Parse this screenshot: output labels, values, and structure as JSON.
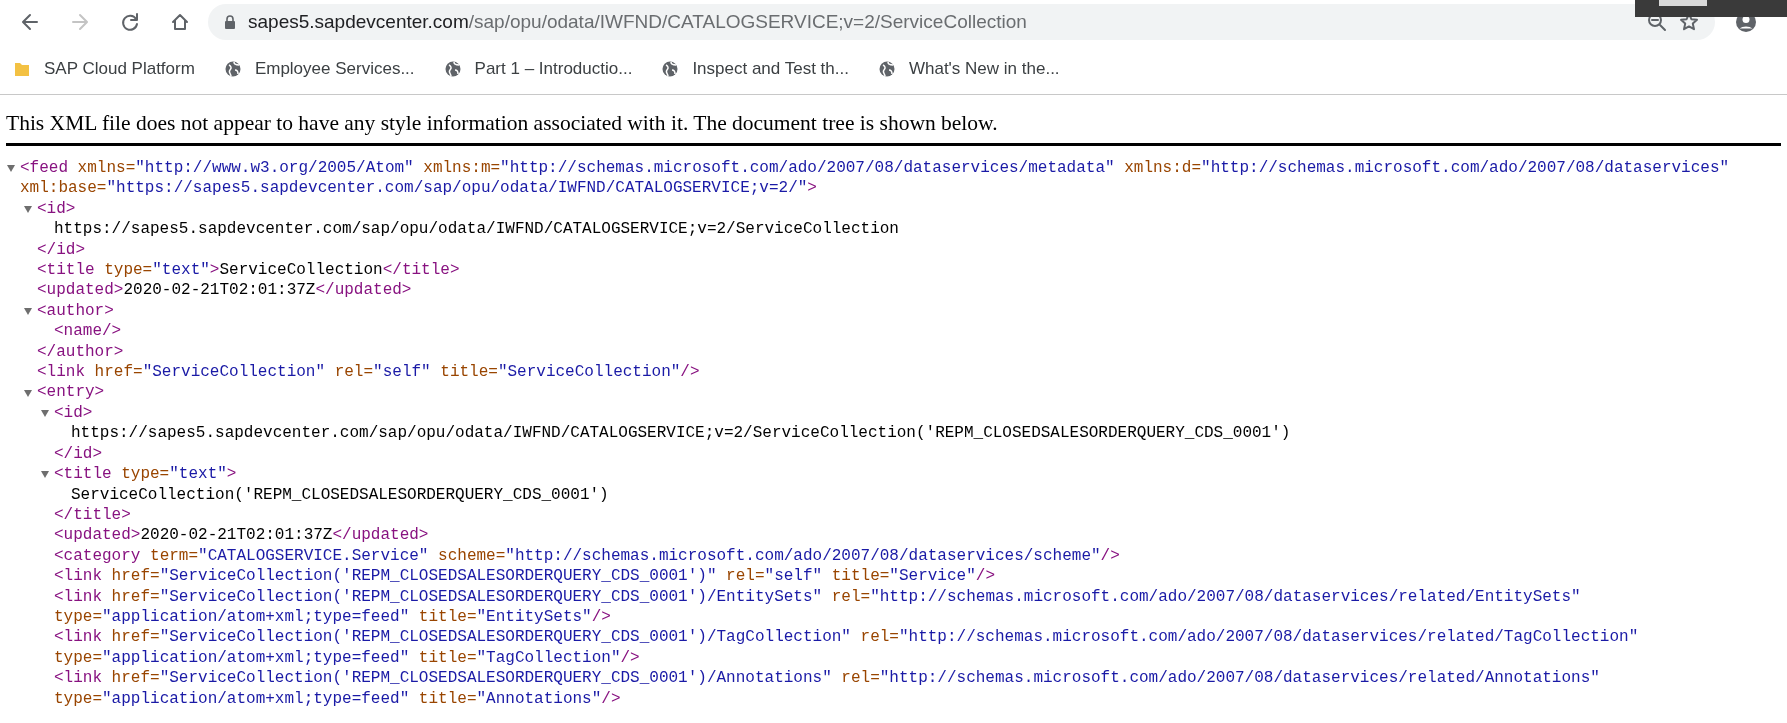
{
  "browser": {
    "back": {
      "disabled": false
    },
    "forward": {
      "disabled": true
    },
    "address": {
      "host": "sapes5.sapdevcenter.com",
      "path": "/sap/opu/odata/IWFND/CATALOGSERVICE;v=2/ServiceCollection"
    },
    "bookmarks": [
      {
        "kind": "folder",
        "label": "SAP Cloud Platform"
      },
      {
        "kind": "page",
        "label": "Employee Services..."
      },
      {
        "kind": "page",
        "label": "Part 1 – Introductio..."
      },
      {
        "kind": "page",
        "label": "Inspect and Test th..."
      },
      {
        "kind": "page",
        "label": "What's New in the..."
      }
    ]
  },
  "notice": "This XML file does not appear to have any style information associated with it. The document tree is shown below.",
  "xml_tree": {
    "expanded": true,
    "open": [
      [
        {
          "kind": "tag",
          "text": "<feed"
        },
        {
          "kind": "attr",
          "text": " xmlns="
        },
        {
          "kind": "value",
          "text": "\"http://www.w3.org/2005/Atom\""
        },
        {
          "kind": "attr",
          "text": " xmlns:m="
        },
        {
          "kind": "value",
          "text": "\"http://schemas.microsoft.com/ado/2007/08/dataservices/metadata\""
        },
        {
          "kind": "attr",
          "text": " xmlns:d="
        },
        {
          "kind": "value",
          "text": "\"http://schemas.microsoft.com/ado/2007/08/dataservices\""
        }
      ],
      [
        {
          "kind": "attr",
          "text": "xml:base="
        },
        {
          "kind": "value",
          "text": "\"https://sapes5.sapdevcenter.com/sap/opu/odata/IWFND/CATALOGSERVICE;v=2/\""
        },
        {
          "kind": "tag",
          "text": ">"
        }
      ]
    ],
    "children": [
      {
        "expanded": true,
        "open": [
          [
            {
              "kind": "tag",
              "text": "<id>"
            }
          ]
        ],
        "children": [
          {
            "lines": [
              [
                {
                  "kind": "text",
                  "text": "https://sapes5.sapdevcenter.com/sap/opu/odata/IWFND/CATALOGSERVICE;v=2/ServiceCollection"
                }
              ]
            ]
          }
        ],
        "close": [
          {
            "kind": "tag",
            "text": "</id>"
          }
        ]
      },
      {
        "lines": [
          [
            {
              "kind": "tag",
              "text": "<title"
            },
            {
              "kind": "attr",
              "text": " type="
            },
            {
              "kind": "value",
              "text": "\"text\""
            },
            {
              "kind": "tag",
              "text": ">"
            },
            {
              "kind": "text",
              "text": "ServiceCollection"
            },
            {
              "kind": "tag",
              "text": "</title>"
            }
          ]
        ]
      },
      {
        "lines": [
          [
            {
              "kind": "tag",
              "text": "<updated>"
            },
            {
              "kind": "text",
              "text": "2020-02-21T02:01:37Z"
            },
            {
              "kind": "tag",
              "text": "</updated>"
            }
          ]
        ]
      },
      {
        "expanded": true,
        "open": [
          [
            {
              "kind": "tag",
              "text": "<author>"
            }
          ]
        ],
        "children": [
          {
            "lines": [
              [
                {
                  "kind": "tag",
                  "text": "<name/>"
                }
              ]
            ]
          }
        ],
        "close": [
          {
            "kind": "tag",
            "text": "</author>"
          }
        ]
      },
      {
        "lines": [
          [
            {
              "kind": "tag",
              "text": "<link"
            },
            {
              "kind": "attr",
              "text": " href="
            },
            {
              "kind": "value",
              "text": "\"ServiceCollection\""
            },
            {
              "kind": "attr",
              "text": " rel="
            },
            {
              "kind": "value",
              "text": "\"self\""
            },
            {
              "kind": "attr",
              "text": " title="
            },
            {
              "kind": "value",
              "text": "\"ServiceCollection\""
            },
            {
              "kind": "tag",
              "text": "/>"
            }
          ]
        ]
      },
      {
        "expanded": true,
        "open": [
          [
            {
              "kind": "tag",
              "text": "<entry>"
            }
          ]
        ],
        "children": [
          {
            "expanded": true,
            "open": [
              [
                {
                  "kind": "tag",
                  "text": "<id>"
                }
              ]
            ],
            "children": [
              {
                "lines": [
                  [
                    {
                      "kind": "text",
                      "text": "https://sapes5.sapdevcenter.com/sap/opu/odata/IWFND/CATALOGSERVICE;v=2/ServiceCollection('REPM_CLOSEDSALESORDERQUERY_CDS_0001')"
                    }
                  ]
                ]
              }
            ],
            "close": [
              {
                "kind": "tag",
                "text": "</id>"
              }
            ]
          },
          {
            "expanded": true,
            "open": [
              [
                {
                  "kind": "tag",
                  "text": "<title"
                },
                {
                  "kind": "attr",
                  "text": " type="
                },
                {
                  "kind": "value",
                  "text": "\"text\""
                },
                {
                  "kind": "tag",
                  "text": ">"
                }
              ]
            ],
            "children": [
              {
                "lines": [
                  [
                    {
                      "kind": "text",
                      "text": "ServiceCollection('REPM_CLOSEDSALESORDERQUERY_CDS_0001')"
                    }
                  ]
                ]
              }
            ],
            "close": [
              {
                "kind": "tag",
                "text": "</title>"
              }
            ]
          },
          {
            "lines": [
              [
                {
                  "kind": "tag",
                  "text": "<updated>"
                },
                {
                  "kind": "text",
                  "text": "2020-02-21T02:01:37Z"
                },
                {
                  "kind": "tag",
                  "text": "</updated>"
                }
              ]
            ]
          },
          {
            "lines": [
              [
                {
                  "kind": "tag",
                  "text": "<category"
                },
                {
                  "kind": "attr",
                  "text": " term="
                },
                {
                  "kind": "value",
                  "text": "\"CATALOGSERVICE.Service\""
                },
                {
                  "kind": "attr",
                  "text": " scheme="
                },
                {
                  "kind": "value",
                  "text": "\"http://schemas.microsoft.com/ado/2007/08/dataservices/scheme\""
                },
                {
                  "kind": "tag",
                  "text": "/>"
                }
              ]
            ]
          },
          {
            "lines": [
              [
                {
                  "kind": "tag",
                  "text": "<link"
                },
                {
                  "kind": "attr",
                  "text": " href="
                },
                {
                  "kind": "value",
                  "text": "\"ServiceCollection('REPM_CLOSEDSALESORDERQUERY_CDS_0001')\""
                },
                {
                  "kind": "attr",
                  "text": " rel="
                },
                {
                  "kind": "value",
                  "text": "\"self\""
                },
                {
                  "kind": "attr",
                  "text": " title="
                },
                {
                  "kind": "value",
                  "text": "\"Service\""
                },
                {
                  "kind": "tag",
                  "text": "/>"
                }
              ]
            ]
          },
          {
            "lines": [
              [
                {
                  "kind": "tag",
                  "text": "<link"
                },
                {
                  "kind": "attr",
                  "text": " href="
                },
                {
                  "kind": "value",
                  "text": "\"ServiceCollection('REPM_CLOSEDSALESORDERQUERY_CDS_0001')/EntitySets\""
                },
                {
                  "kind": "attr",
                  "text": " rel="
                },
                {
                  "kind": "value",
                  "text": "\"http://schemas.microsoft.com/ado/2007/08/dataservices/related/EntitySets\""
                }
              ],
              [
                {
                  "kind": "attr",
                  "text": "type="
                },
                {
                  "kind": "value",
                  "text": "\"application/atom+xml;type=feed\""
                },
                {
                  "kind": "attr",
                  "text": " title="
                },
                {
                  "kind": "value",
                  "text": "\"EntitySets\""
                },
                {
                  "kind": "tag",
                  "text": "/>"
                }
              ]
            ]
          },
          {
            "lines": [
              [
                {
                  "kind": "tag",
                  "text": "<link"
                },
                {
                  "kind": "attr",
                  "text": " href="
                },
                {
                  "kind": "value",
                  "text": "\"ServiceCollection('REPM_CLOSEDSALESORDERQUERY_CDS_0001')/TagCollection\""
                },
                {
                  "kind": "attr",
                  "text": " rel="
                },
                {
                  "kind": "value",
                  "text": "\"http://schemas.microsoft.com/ado/2007/08/dataservices/related/TagCollection\""
                }
              ],
              [
                {
                  "kind": "attr",
                  "text": "type="
                },
                {
                  "kind": "value",
                  "text": "\"application/atom+xml;type=feed\""
                },
                {
                  "kind": "attr",
                  "text": " title="
                },
                {
                  "kind": "value",
                  "text": "\"TagCollection\""
                },
                {
                  "kind": "tag",
                  "text": "/>"
                }
              ]
            ]
          },
          {
            "lines": [
              [
                {
                  "kind": "tag",
                  "text": "<link"
                },
                {
                  "kind": "attr",
                  "text": " href="
                },
                {
                  "kind": "value",
                  "text": "\"ServiceCollection('REPM_CLOSEDSALESORDERQUERY_CDS_0001')/Annotations\""
                },
                {
                  "kind": "attr",
                  "text": " rel="
                },
                {
                  "kind": "value",
                  "text": "\"http://schemas.microsoft.com/ado/2007/08/dataservices/related/Annotations\""
                }
              ],
              [
                {
                  "kind": "attr",
                  "text": "type="
                },
                {
                  "kind": "value",
                  "text": "\"application/atom+xml;type=feed\""
                },
                {
                  "kind": "attr",
                  "text": " title="
                },
                {
                  "kind": "value",
                  "text": "\"Annotations\""
                },
                {
                  "kind": "tag",
                  "text": "/>"
                }
              ]
            ]
          }
        ]
      }
    ]
  }
}
